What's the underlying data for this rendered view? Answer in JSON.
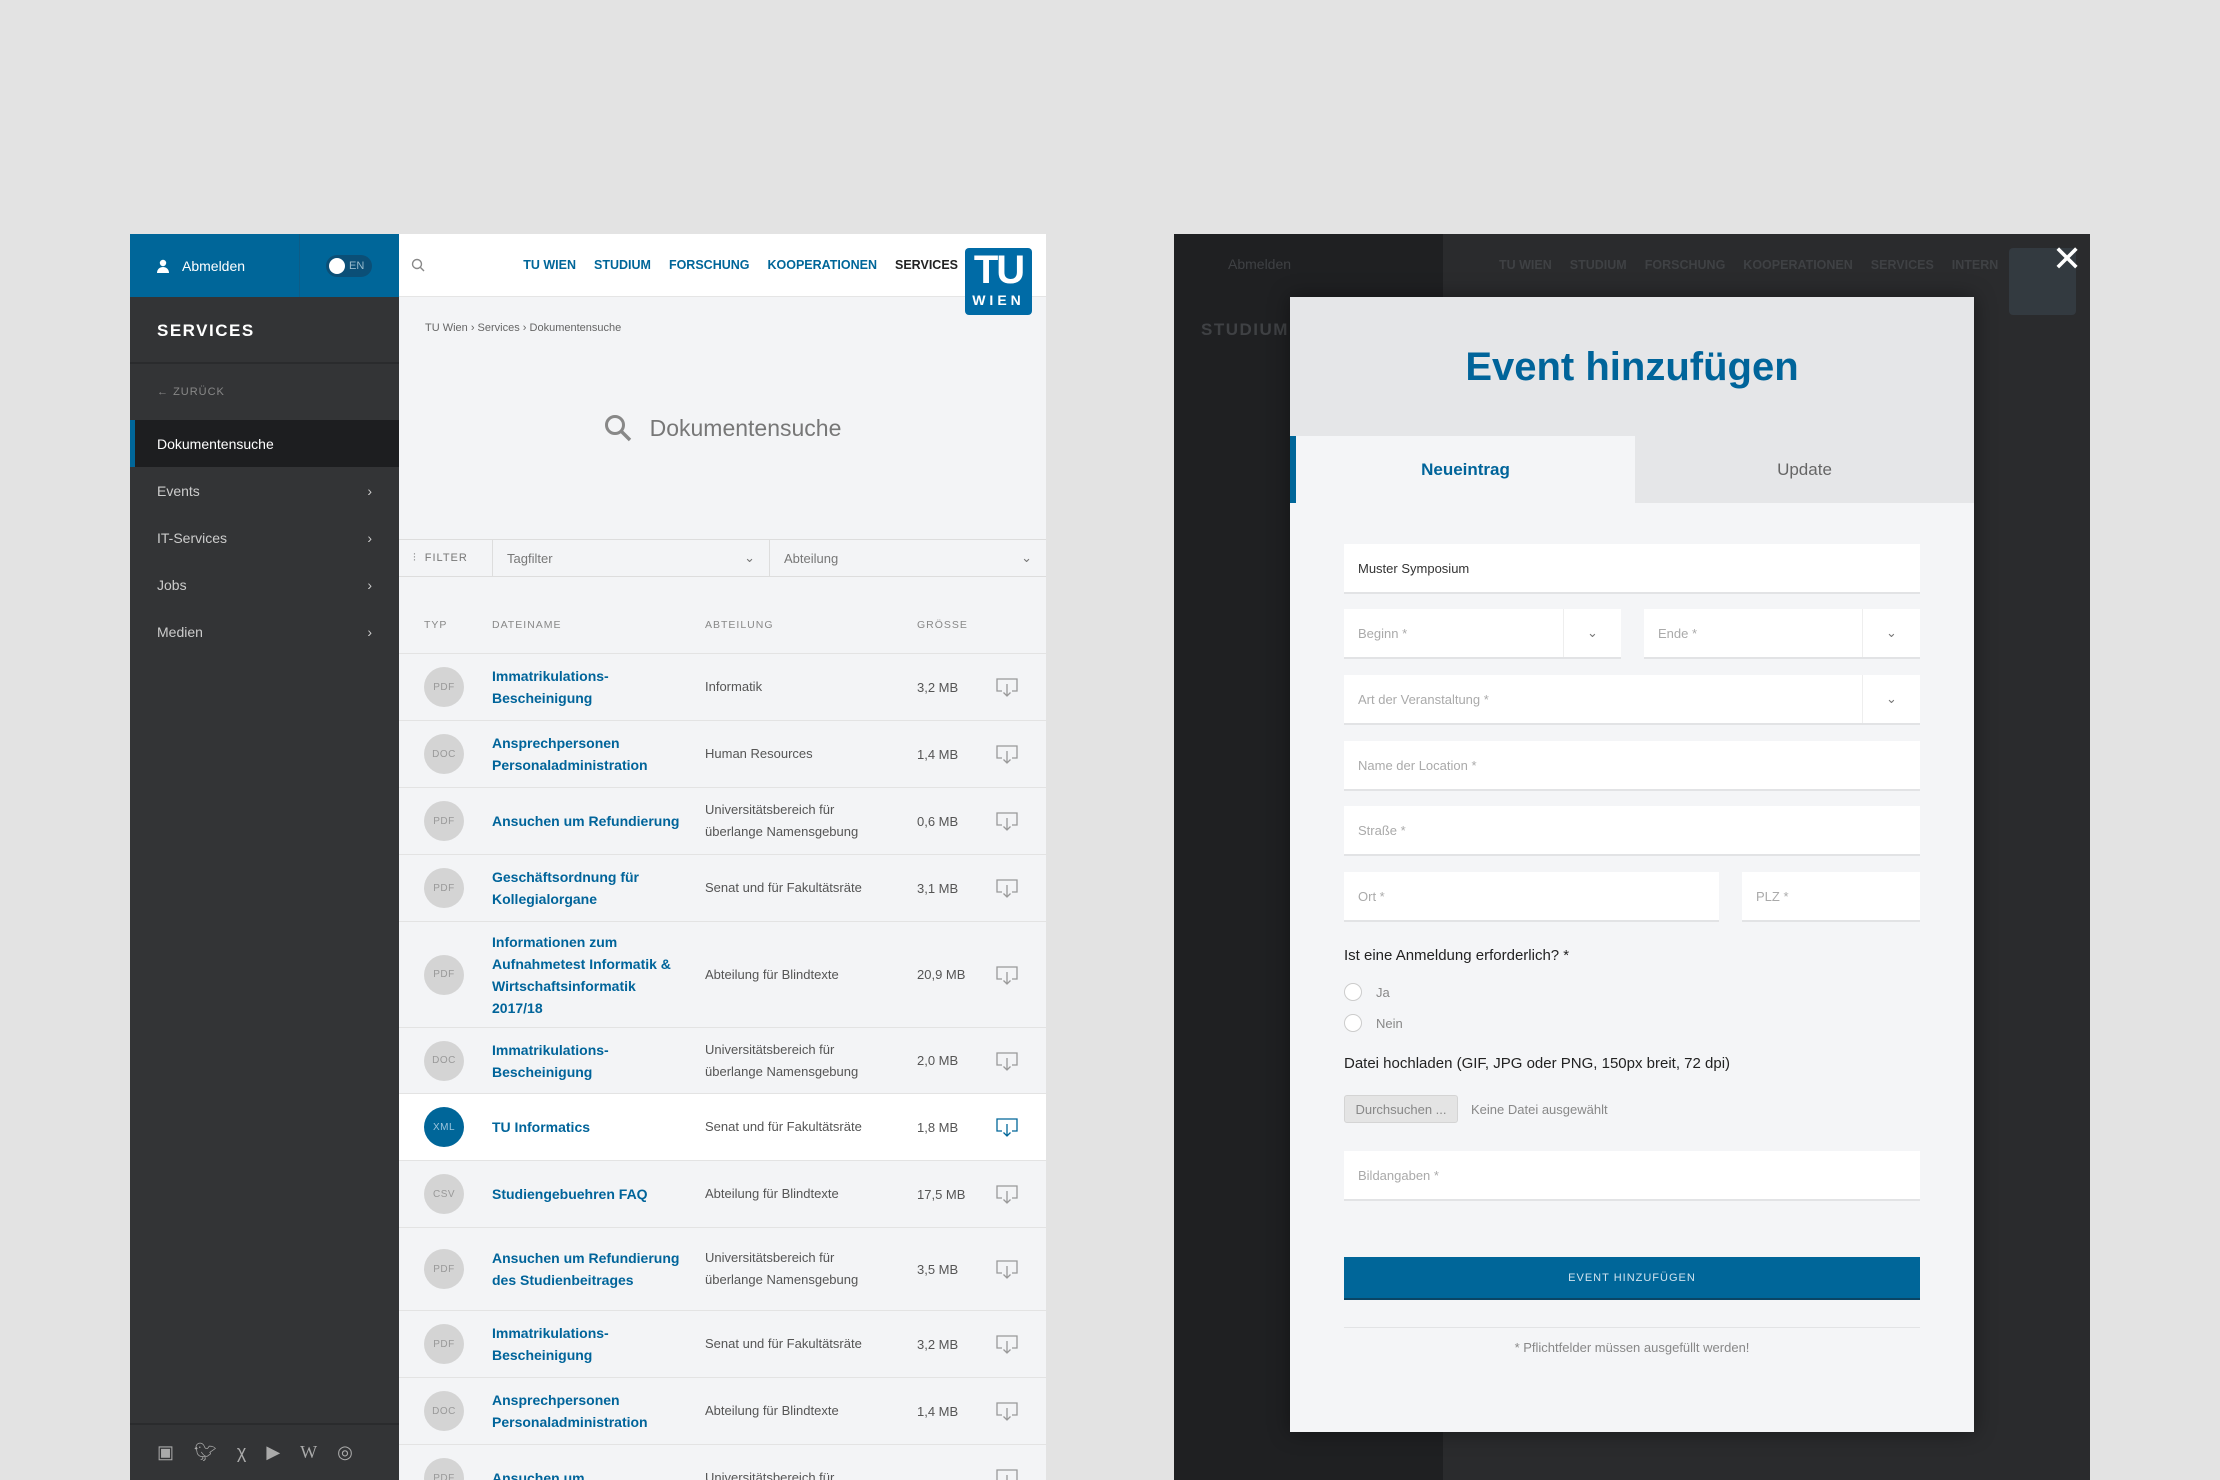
{
  "colors": {
    "brand": "#006699",
    "sidebar": "#333436",
    "overlay": "#2a2b2d"
  },
  "left": {
    "user": {
      "logout": "Abmelden",
      "lang": "EN",
      "icon": "user-icon"
    },
    "sidebar": {
      "title": "SERVICES",
      "back": "ZURÜCK",
      "items": [
        {
          "label": "Dokumentensuche",
          "active": true
        },
        {
          "label": "Events"
        },
        {
          "label": "IT-Services"
        },
        {
          "label": "Jobs"
        },
        {
          "label": "Medien"
        }
      ],
      "social": [
        "facebook-icon",
        "twitter-icon",
        "xing-icon",
        "youtube-icon",
        "wikipedia-icon",
        "issuu-icon"
      ]
    },
    "nav": [
      "TU WIEN",
      "STUDIUM",
      "FORSCHUNG",
      "KOOPERATIONEN",
      "SERVICES"
    ],
    "logo": {
      "top": "TU",
      "bottom": "WIEN"
    },
    "breadcrumb": "TU Wien › Services › Dokumentensuche",
    "search_title": "Dokumentensuche",
    "filter": {
      "label": "FILTER",
      "tag": "Tagfilter",
      "dept": "Abteilung"
    },
    "table": {
      "headers": [
        "TYP",
        "DATEINAME",
        "ABTEILUNG",
        "GRÖSSE"
      ],
      "rows": [
        {
          "type": "PDF",
          "name": "Immatrikulations-Bescheinigung",
          "dept": "Informatik",
          "size": "3,2 MB"
        },
        {
          "type": "DOC",
          "name": "Ansprechpersonen Personaladministration",
          "dept": "Human Resources",
          "size": "1,4 MB"
        },
        {
          "type": "PDF",
          "name": "Ansuchen um Refundierung",
          "dept": "Universitätsbereich für überlange Namensgebung",
          "size": "0,6 MB"
        },
        {
          "type": "PDF",
          "name": "Geschäftsordnung für Kollegialorgane",
          "dept": "Senat und für Fakultätsräte",
          "size": "3,1 MB"
        },
        {
          "type": "PDF",
          "name": "Informationen zum Aufnahmetest Informatik & Wirtschaftsinformatik 2017/18",
          "dept": "Abteilung für Blindtexte",
          "size": "20,9 MB"
        },
        {
          "type": "DOC",
          "name": "Immatrikulations-Bescheinigung",
          "dept": "Universitätsbereich für überlange Namensgebung",
          "size": "2,0 MB"
        },
        {
          "type": "XML",
          "name": "TU Informatics",
          "dept": "Senat und für Fakultätsräte",
          "size": "1,8 MB",
          "highlight": true
        },
        {
          "type": "CSV",
          "name": "Studiengebuehren FAQ",
          "dept": "Abteilung für Blindtexte",
          "size": "17,5 MB"
        },
        {
          "type": "PDF",
          "name": "Ansuchen um Refundierung des Studienbeitrages",
          "dept": "Universitätsbereich für überlange Namensgebung",
          "size": "3,5 MB"
        },
        {
          "type": "PDF",
          "name": "Immatrikulations-Bescheinigung",
          "dept": "Senat und für Fakultätsräte",
          "size": "3,2 MB"
        },
        {
          "type": "DOC",
          "name": "Ansprechpersonen Personaladministration",
          "dept": "Abteilung für Blindtexte",
          "size": "1,4 MB"
        },
        {
          "type": "PDF",
          "name": "Ansuchen um",
          "dept": "Universitätsbereich für",
          "size": ""
        }
      ]
    }
  },
  "right": {
    "bg_nav": [
      "TU WIEN",
      "STUDIUM",
      "FORSCHUNG",
      "KOOPERATIONEN",
      "SERVICES",
      "INTERN"
    ],
    "bg_user": "Abmelden",
    "bg_sidebar_title": "STUDIUM",
    "modal": {
      "title": "Event hinzufügen",
      "tabs": [
        "Neueintrag",
        "Update"
      ],
      "fields": {
        "name": "Muster Symposium",
        "begin": "Beginn *",
        "end": "Ende *",
        "type": "Art der Veranstaltung *",
        "location": "Name der Location *",
        "street": "Straße *",
        "city": "Ort *",
        "zip": "PLZ *",
        "image_info": "Bildangaben *"
      },
      "question": "Ist eine Anmeldung erforderlich? *",
      "options": [
        "Ja",
        "Nein"
      ],
      "upload_label": "Datei hochladen (GIF, JPG oder PNG, 150px breit, 72 dpi)",
      "browse": "Durchsuchen ...",
      "no_file": "Keine Datei ausgewählt",
      "submit": "EVENT HINZUFÜGEN",
      "footnote": "* Pflichtfelder müssen ausgefüllt werden!"
    }
  }
}
